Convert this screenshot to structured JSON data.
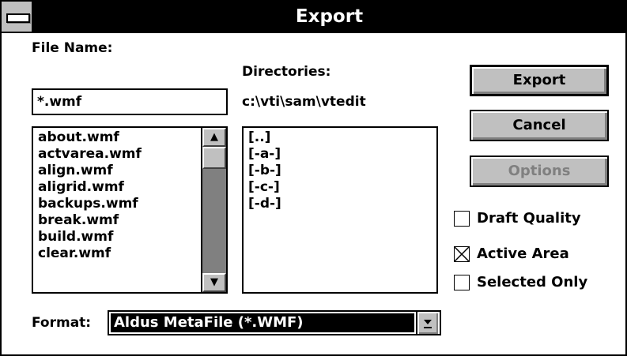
{
  "window": {
    "title": "Export"
  },
  "file_name": {
    "label": "File Name:",
    "value": "*.wmf"
  },
  "files": [
    "about.wmf",
    "actvarea.wmf",
    "align.wmf",
    "aligrid.wmf",
    "backups.wmf",
    "break.wmf",
    "build.wmf",
    "clear.wmf"
  ],
  "directories": {
    "label": "Directories:",
    "path": "c:\\vti\\sam\\vtedit",
    "items": [
      "[..]",
      "[-a-]",
      "[-b-]",
      "[-c-]",
      "[-d-]"
    ]
  },
  "buttons": {
    "export": "Export",
    "cancel": "Cancel",
    "options": "Options"
  },
  "checkboxes": [
    {
      "label": "Draft Quality",
      "checked": false
    },
    {
      "label": "Active Area",
      "checked": true
    },
    {
      "label": "Selected Only",
      "checked": false
    }
  ],
  "format": {
    "label": "Format:",
    "value": "Aldus MetaFile (*.WMF)"
  }
}
